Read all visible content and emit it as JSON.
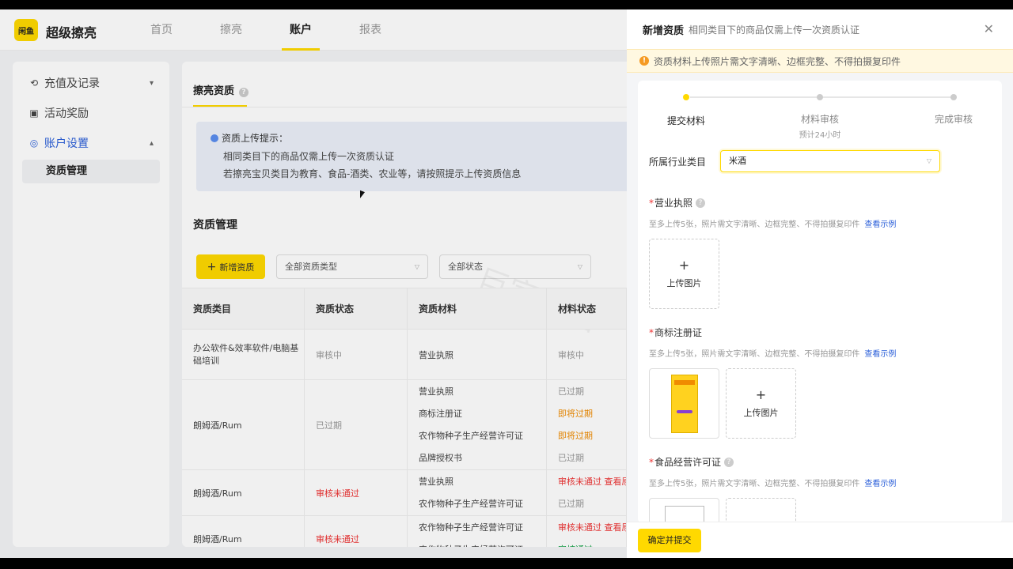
{
  "header": {
    "logo_text": "闲鱼",
    "brand": "超级擦亮",
    "nav": [
      {
        "label": "首页"
      },
      {
        "label": "擦亮"
      },
      {
        "label": "账户",
        "active": true
      },
      {
        "label": "报表"
      }
    ]
  },
  "sidebar": {
    "items": [
      {
        "label": "充值及记录",
        "icon": "refresh-icon"
      },
      {
        "label": "活动奖励",
        "icon": "gift-icon"
      },
      {
        "label": "账户设置",
        "icon": "settings-icon"
      }
    ],
    "sub_item": "资质管理"
  },
  "main": {
    "tab": "擦亮资质",
    "tip": {
      "title": "资质上传提示：",
      "line1": "相同类目下的商品仅需上传一次资质认证",
      "line2": "若擦亮宝贝类目为教育、食品-酒类、农业等，请按照提示上传资质信息"
    },
    "section_title": "资质管理",
    "add_button": "新增资质",
    "filter1": "全部资质类型",
    "filter2": "全部状态",
    "watermark": "巨宣网络",
    "columns": [
      "资质类目",
      "资质状态",
      "资质材料",
      "材料状态"
    ],
    "rows": [
      {
        "category": "办公软件&效率软件/电脑基础培训",
        "status": "审核中",
        "materials": [
          {
            "name": "营业执照",
            "state": "审核中"
          }
        ]
      },
      {
        "category": "朗姆酒/Rum",
        "status": "已过期",
        "materials": [
          {
            "name": "营业执照",
            "state": "已过期"
          },
          {
            "name": "商标注册证",
            "state": "即将过期"
          },
          {
            "name": "农作物种子生产经营许可证",
            "state": "即将过期"
          },
          {
            "name": "品牌授权书",
            "state": "已过期"
          }
        ]
      },
      {
        "category": "朗姆酒/Rum",
        "status": "审核未通过",
        "materials": [
          {
            "name": "营业执照",
            "state": "审核未通过 查看原"
          },
          {
            "name": "农作物种子生产经营许可证",
            "state": "已过期"
          }
        ]
      },
      {
        "category": "朗姆酒/Rum",
        "status": "审核未通过",
        "materials": [
          {
            "name": "农作物种子生产经营许可证",
            "state": "审核未通过 查看原"
          },
          {
            "name": "农作物种子生产经营许可证",
            "state": "审核通过"
          }
        ]
      }
    ]
  },
  "drawer": {
    "title": "新增资质",
    "subtitle": "相同类目下的商品仅需上传一次资质认证",
    "warning": "资质材料上传照片需文字清晰、边框完整、不得拍摄复印件",
    "steps": [
      {
        "label": "提交材料",
        "note": ""
      },
      {
        "label": "材料审核",
        "note": "预计24小时"
      },
      {
        "label": "完成审核",
        "note": ""
      }
    ],
    "industry_label": "所属行业类目",
    "industry_value": "米酒",
    "hint": "至多上传5张，照片需文字清晰、边框完整、不得拍摄复印件",
    "hint_link": "查看示例",
    "upload_label": "上传图片",
    "fields": [
      {
        "title": "营业执照"
      },
      {
        "title": "商标注册证"
      },
      {
        "title": "食品经营许可证"
      }
    ],
    "submit": "确定并提交"
  }
}
